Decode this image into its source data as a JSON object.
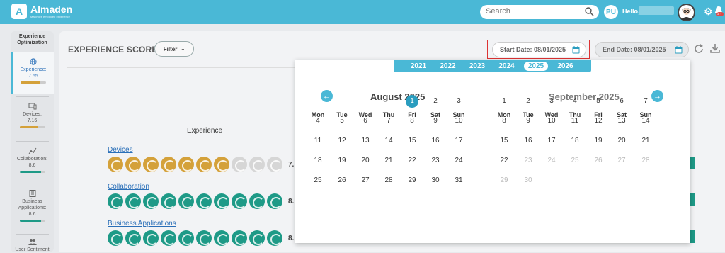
{
  "app": {
    "name": "Almaden",
    "tagline": "Maximize employee experience",
    "colors": {
      "brand": "#4ab8d6",
      "gold": "#d4a13a",
      "teal": "#1e9a87",
      "grey_globe": "#d6d6d6"
    }
  },
  "header": {
    "search_placeholder": "Search",
    "avatar_initials": "PU",
    "greeting": "Hello,",
    "notification_badge": "9+"
  },
  "sidebar": {
    "title": "Experience Optimization",
    "items": [
      {
        "label": "Experience:",
        "value": "7.55",
        "icon": "globe-icon",
        "progress": 0.755,
        "color": "#d4a13a"
      },
      {
        "label": "Devices:",
        "value": "7.16",
        "icon": "devices-icon",
        "progress": 0.716,
        "color": "#d4a13a"
      },
      {
        "label": "Collaboration:",
        "value": "8.6",
        "icon": "collaboration-icon",
        "progress": 0.86,
        "color": "#1e9a87"
      },
      {
        "label": "Business Applications:",
        "value": "8.6",
        "icon": "building-icon",
        "progress": 0.86,
        "color": "#1e9a87"
      },
      {
        "label": "User Sentiment",
        "value": "",
        "icon": "users-icon",
        "progress": 0,
        "color": "#1e9a87"
      }
    ]
  },
  "main": {
    "title": "EXPERIENCE SCORE",
    "filter_label": "Filter",
    "start_date_label": "Start Date: 08/01/2025",
    "end_date_label": "End Date: 08/01/2025",
    "experience_label": "Experience",
    "categories": [
      {
        "name": "Devices",
        "score": "7.",
        "filled": 7,
        "total": 10,
        "color": "#d4a13a"
      },
      {
        "name": "Collaboration",
        "score": "8.",
        "filled": 10,
        "total": 10,
        "color": "#1e9a87"
      },
      {
        "name": "Business Applications",
        "score": "8.",
        "filled": 10,
        "total": 10,
        "color": "#1e9a87"
      }
    ]
  },
  "calendar": {
    "years": [
      "2021",
      "2022",
      "2023",
      "2024",
      "2025",
      "2026"
    ],
    "selected_year": "2025",
    "weekdays": [
      "Mon",
      "Tue",
      "Wed",
      "Thu",
      "Fri",
      "Sat",
      "Sun"
    ],
    "left": {
      "title": "August 2025",
      "first_col": 4,
      "days": 31,
      "selected_day": 1
    },
    "right": {
      "title": "September 2025",
      "first_col": 0,
      "days": 30,
      "enabled_until": 22
    },
    "prev_glyph": "←",
    "next_glyph": "→"
  }
}
